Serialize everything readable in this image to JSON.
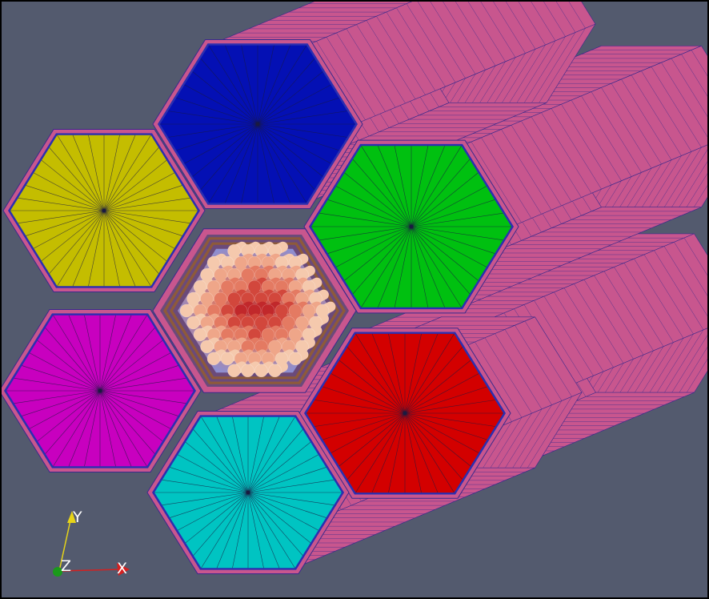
{
  "viewport": {
    "background": "#535a6e",
    "frame_color": "#000000"
  },
  "assembly": {
    "duct_side_color": "#c8568e",
    "duct_mesh_color": "#3a2a8c",
    "rim_color": "#2b2fb0",
    "hexes": [
      {
        "name": "hex-blue",
        "color": "#0410b4"
      },
      {
        "name": "hex-yellow",
        "color": "#c4bd00"
      },
      {
        "name": "hex-green",
        "color": "#00c010"
      },
      {
        "name": "hex-magenta",
        "color": "#c800bf"
      },
      {
        "name": "hex-red",
        "color": "#d30000"
      },
      {
        "name": "hex-cyan",
        "color": "#00c4c2"
      }
    ],
    "center_bundle": {
      "pin_colors": [
        "#f5c9ad",
        "#efa689",
        "#e47a62",
        "#d2473c",
        "#c1282b"
      ]
    }
  },
  "axes_triad": {
    "x_label": "X",
    "y_label": "Y",
    "z_label": "Z",
    "x_color": "#d42020",
    "y_color": "#e7d418",
    "z_color": "#1a9a1a"
  }
}
